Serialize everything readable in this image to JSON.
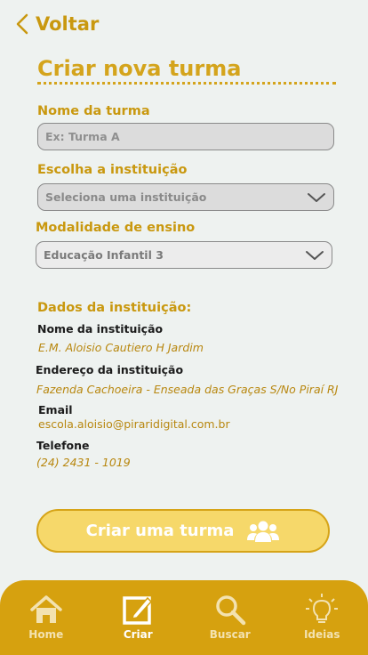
{
  "header": {
    "back_label": "Voltar"
  },
  "form": {
    "title": "Criar nova turma",
    "class_name_label": "Nome da turma",
    "class_name_placeholder": "Ex: Turma A",
    "institution_label": "Escolha a instituição",
    "institution_placeholder": "Seleciona uma instituição",
    "modality_label": "Modalidade de ensino",
    "modality_value": "Educação Infantil 3"
  },
  "institution_data": {
    "heading": "Dados da instituição:",
    "name_label": "Nome da instituição",
    "name_value": "E.M. Aloisio Cautiero H Jardim",
    "address_label": "Endereço da instituição",
    "address_value": "Fazenda Cachoeira -  Enseada das Graças S/No Piraí RJ",
    "email_label": "Email",
    "email_value": "escola.aloisio@piraridigital.com.br",
    "phone_label": "Telefone",
    "phone_value": "(24) 2431 - 1019"
  },
  "cta": {
    "label": "Criar uma turma",
    "icon": "group-icon"
  },
  "nav": {
    "items": [
      {
        "label": "Home",
        "icon": "home-icon"
      },
      {
        "label": "Criar",
        "icon": "edit-icon"
      },
      {
        "label": "Buscar",
        "icon": "search-icon"
      },
      {
        "label": "Ideias",
        "icon": "lightbulb-icon"
      }
    ],
    "active": "Criar"
  },
  "colors": {
    "accent": "#d4a41c",
    "background": "#eef2f0",
    "nav_bar": "#d6a10f",
    "button_fill": "#f6d86a"
  }
}
